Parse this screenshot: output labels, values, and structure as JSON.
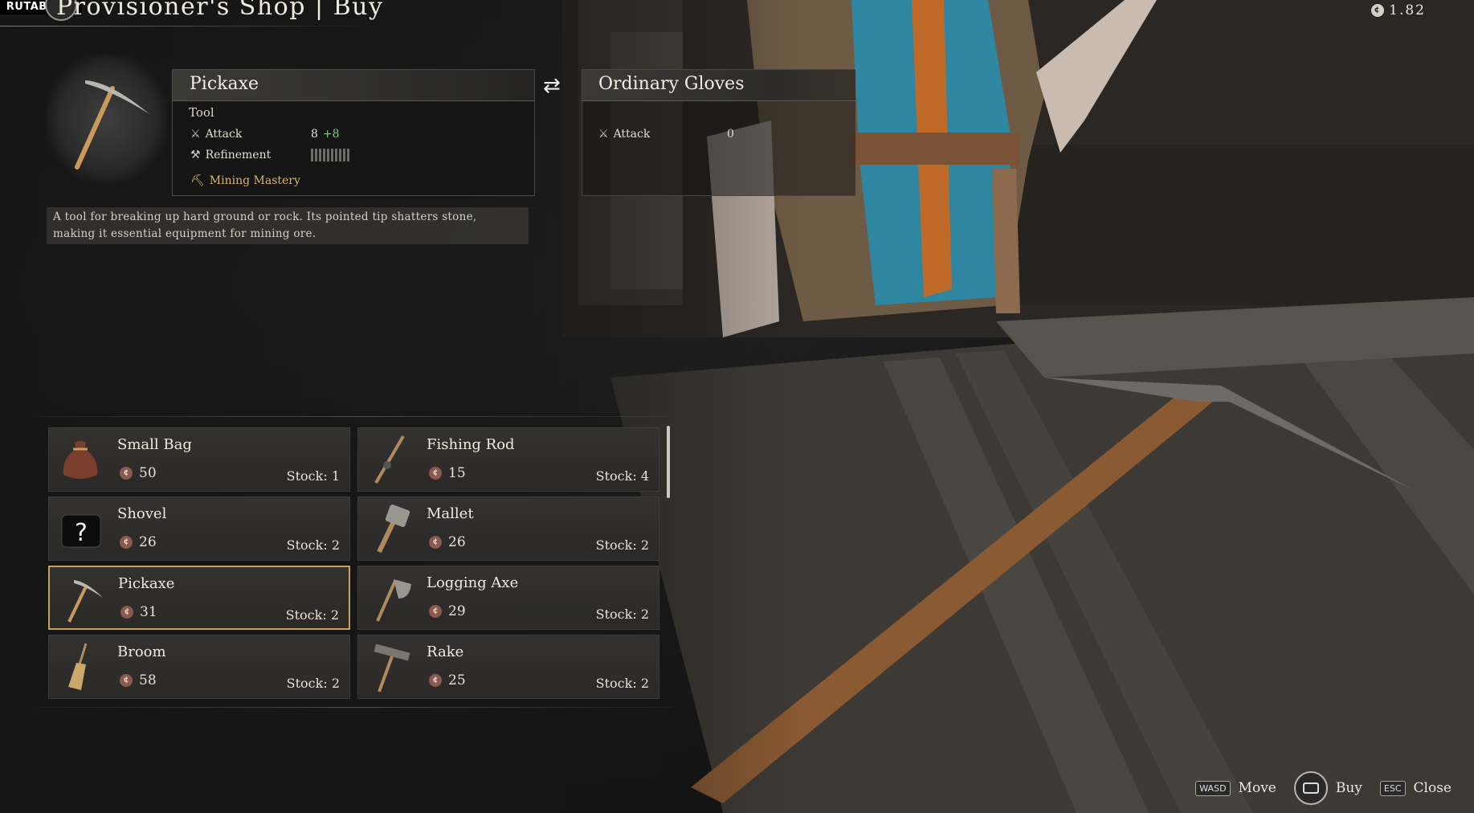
{
  "watermark": "RUTAB.NET",
  "header": {
    "title": "Provisioner's Shop  |  Buy",
    "currency_value": "1.82",
    "currency_icon": "coin-icon"
  },
  "selected_item": {
    "name": "Pickaxe",
    "type": "Tool",
    "stats": {
      "attack_label": "Attack",
      "attack_value": "8",
      "attack_bonus": "+8",
      "refinement_label": "Refinement"
    },
    "mastery": "Mining Mastery",
    "description_line1": "A tool for breaking up hard ground or rock. Its pointed tip shatters stone,",
    "description_line2": "making it essential equipment for mining ore."
  },
  "compare_item": {
    "name": "Ordinary Gloves",
    "attack_label": "Attack",
    "attack_value": "0"
  },
  "shop_items": [
    {
      "name": "Small Bag",
      "price": "50",
      "stock": "Stock: 1",
      "icon": "small-bag-icon"
    },
    {
      "name": "Fishing Rod",
      "price": "15",
      "stock": "Stock: 4",
      "icon": "fishing-rod-icon"
    },
    {
      "name": "Shovel",
      "price": "26",
      "stock": "Stock: 2",
      "icon": "unknown-item-icon"
    },
    {
      "name": "Mallet",
      "price": "26",
      "stock": "Stock: 2",
      "icon": "mallet-icon"
    },
    {
      "name": "Pickaxe",
      "price": "31",
      "stock": "Stock: 2",
      "icon": "pickaxe-icon",
      "selected": true
    },
    {
      "name": "Logging Axe",
      "price": "29",
      "stock": "Stock: 2",
      "icon": "axe-icon"
    },
    {
      "name": "Broom",
      "price": "58",
      "stock": "Stock: 2",
      "icon": "broom-icon"
    },
    {
      "name": "Rake",
      "price": "25",
      "stock": "Stock: 2",
      "icon": "rake-icon"
    }
  ],
  "controls": {
    "move_key": "WASD",
    "move_label": "Move",
    "buy_label": "Buy",
    "close_key": "ESC",
    "close_label": "Close"
  }
}
